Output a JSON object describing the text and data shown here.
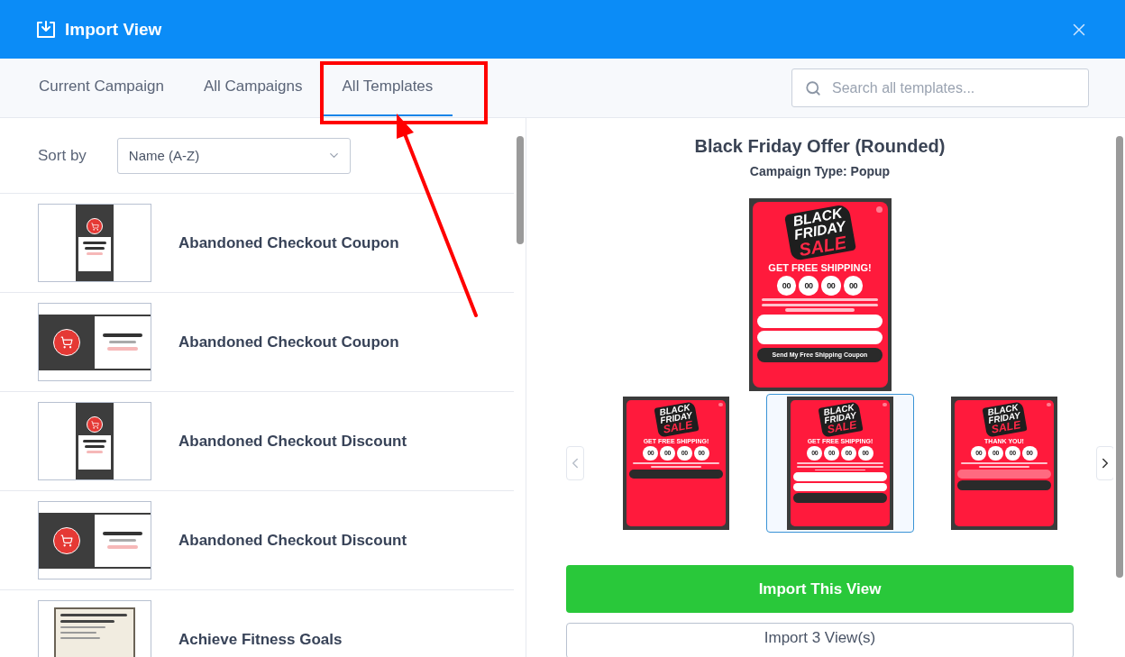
{
  "header": {
    "title": "Import View"
  },
  "tabs": [
    {
      "label": "Current Campaign",
      "selected": false
    },
    {
      "label": "All Campaigns",
      "selected": false
    },
    {
      "label": "All Templates",
      "selected": true
    }
  ],
  "search": {
    "placeholder": "Search all templates..."
  },
  "sort": {
    "label": "Sort by",
    "value": "Name (A-Z)"
  },
  "templates": [
    {
      "name": "Abandoned Checkout Coupon",
      "kind": "portrait"
    },
    {
      "name": "Abandoned Checkout Coupon",
      "kind": "landscape"
    },
    {
      "name": "Abandoned Checkout Discount",
      "kind": "portrait"
    },
    {
      "name": "Abandoned Checkout Discount",
      "kind": "landscape"
    },
    {
      "name": "Achieve Fitness Goals",
      "kind": "document"
    }
  ],
  "preview": {
    "title": "Black Friday Offer (Rounded)",
    "subtitle": "Campaign Type: Popup",
    "main": {
      "kind": "form",
      "badge": [
        "BLACK",
        "FRIDAY",
        "SALE"
      ],
      "headline": "GET FREE SHIPPING!",
      "timer": [
        "00",
        "00",
        "00",
        "00"
      ],
      "button": "Send My Free Shipping Coupon"
    },
    "thumbnails": [
      {
        "selected": false,
        "popup": {
          "kind": "teaser",
          "badge": [
            "BLACK",
            "FRIDAY",
            "SALE"
          ],
          "headline": "GET FREE SHIPPING!",
          "timer": [
            "00",
            "00",
            "00",
            "00"
          ]
        }
      },
      {
        "selected": true,
        "popup": {
          "kind": "form",
          "badge": [
            "BLACK",
            "FRIDAY",
            "SALE"
          ],
          "headline": "GET FREE SHIPPING!",
          "timer": [
            "00",
            "00",
            "00",
            "00"
          ]
        }
      },
      {
        "selected": false,
        "popup": {
          "kind": "success",
          "badge": [
            "BLACK",
            "FRIDAY",
            "SALE"
          ],
          "headline": "THANK YOU!",
          "timer": [
            "00",
            "00",
            "00",
            "00"
          ]
        }
      }
    ]
  },
  "buttons": [
    {
      "label": "Import This View",
      "kind": "primary"
    },
    {
      "label": "Import 3 View(s)",
      "kind": "secondary"
    }
  ]
}
